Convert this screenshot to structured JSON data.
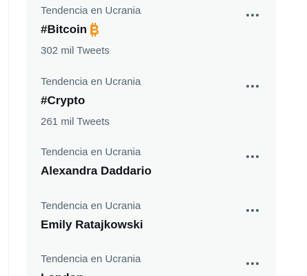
{
  "trends": [
    {
      "context": "Tendencia en Ucrania",
      "name": "#Bitcoin",
      "emoji": "bitcoin-icon",
      "count": "302 mil Tweets"
    },
    {
      "context": "Tendencia en Ucrania",
      "name": "#Crypto",
      "count": "261 mil Tweets"
    },
    {
      "context": "Tendencia en Ucrania",
      "name": "Alexandra Daddario"
    },
    {
      "context": "Tendencia en Ucrania",
      "name": "Emily Ratajkowski"
    },
    {
      "context": "Tendencia en Ucrania",
      "name": "London"
    }
  ],
  "colors": {
    "panel_background": "#f7f9f9",
    "secondary_text": "#536471",
    "primary_text": "#0f1419",
    "bitcoin_orange": "#f7931a"
  },
  "icons": {
    "more": "more-options-icon"
  }
}
